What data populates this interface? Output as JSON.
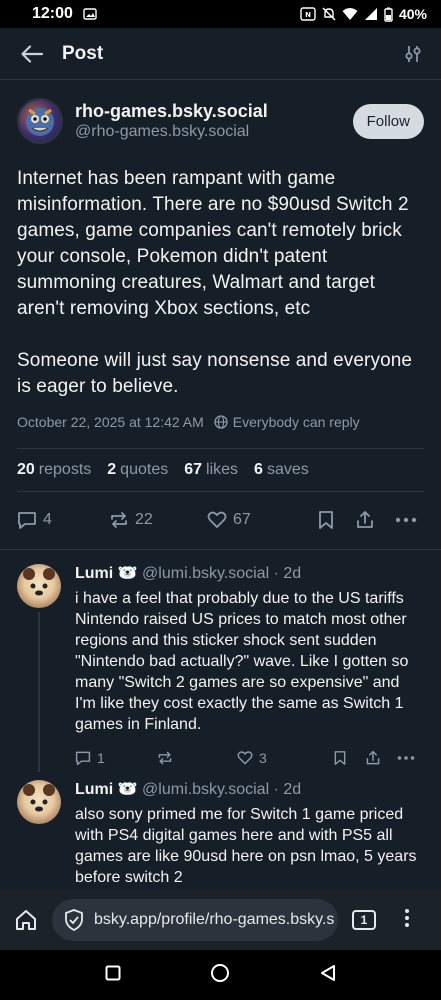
{
  "status_bar": {
    "time": "12:00",
    "battery": "40%"
  },
  "header": {
    "title": "Post"
  },
  "post": {
    "display_name": "rho-games.bsky.social",
    "handle": "@rho-games.bsky.social",
    "follow_label": "Follow",
    "text": "Internet has been rampant with game misinformation. There are no $90usd Switch 2 games, game companies can't remotely brick your console, Pokemon didn't patent summoning creatures, Walmart and target aren't removing Xbox sections, etc\n\nSomeone will just say nonsense and everyone is eager to believe.",
    "timestamp": "October 22, 2025 at 12:42 AM",
    "reply_setting": "Everybody can reply",
    "counts": {
      "reposts": "20",
      "reposts_label": "reposts",
      "quotes": "2",
      "quotes_label": "quotes",
      "likes": "67",
      "likes_label": "likes",
      "saves": "6",
      "saves_label": "saves"
    },
    "actions": {
      "replies": "4",
      "reposts": "22",
      "likes": "67"
    }
  },
  "replies": [
    {
      "name": "Lumi 🐻‍❄️",
      "handle": "@lumi.bsky.social · 2d",
      "text": "i have a feel that probably due to the US tariffs Nintendo raised US prices to match most other regions and this sticker shock sent sudden \"Nintendo bad actually?\" wave. Like I gotten so many \"Switch 2 games are so expensive\" and I'm like they cost exactly the same as Switch 1 games in Finland.",
      "replies": "1",
      "likes": "3"
    },
    {
      "name": "Lumi 🐻‍❄️",
      "handle": "@lumi.bsky.social · 2d",
      "text": "also sony primed me for Switch 1 game priced with PS4 digital games here and with PS5 all games are like 90usd here on psn lmao, 5 years before switch 2"
    }
  ],
  "browser": {
    "url": "bsky.app/profile/rho-games.bsky.s",
    "tab_count": "1"
  }
}
